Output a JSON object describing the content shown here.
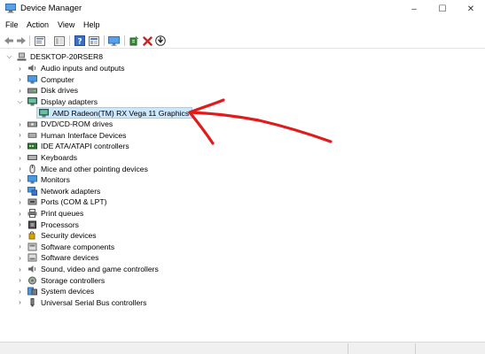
{
  "window": {
    "title": "Device Manager",
    "controls": {
      "minimize": "–",
      "maximize": "☐",
      "close": "✕"
    }
  },
  "menu": [
    "File",
    "Action",
    "View",
    "Help"
  ],
  "toolbar": {
    "buttons": [
      "back-icon",
      "forward-icon",
      "properties-sheet-icon",
      "show-hide-console-tree-icon",
      "help-icon",
      "action-pane-icon",
      "monitor-icon",
      "update-driver-icon",
      "uninstall-icon",
      "scan-hardware-icon"
    ]
  },
  "tree": {
    "root": {
      "label": "DESKTOP-20RSER8",
      "expanded": true
    },
    "categories": [
      {
        "label": "Audio inputs and outputs",
        "expanded": false
      },
      {
        "label": "Computer",
        "expanded": false
      },
      {
        "label": "Disk drives",
        "expanded": false
      },
      {
        "label": "Display adapters",
        "expanded": true
      },
      {
        "label": "AMD Radeon(TM) RX Vega 11 Graphics",
        "child": true,
        "selected": true
      },
      {
        "label": "DVD/CD-ROM drives",
        "expanded": false
      },
      {
        "label": "Human Interface Devices",
        "expanded": false
      },
      {
        "label": "IDE ATA/ATAPI controllers",
        "expanded": false
      },
      {
        "label": "Keyboards",
        "expanded": false
      },
      {
        "label": "Mice and other pointing devices",
        "expanded": false
      },
      {
        "label": "Monitors",
        "expanded": false
      },
      {
        "label": "Network adapters",
        "expanded": false
      },
      {
        "label": "Ports (COM & LPT)",
        "expanded": false
      },
      {
        "label": "Print queues",
        "expanded": false
      },
      {
        "label": "Processors",
        "expanded": false
      },
      {
        "label": "Security devices",
        "expanded": false
      },
      {
        "label": "Software components",
        "expanded": false
      },
      {
        "label": "Software devices",
        "expanded": false
      },
      {
        "label": "Sound, video and game controllers",
        "expanded": false
      },
      {
        "label": "Storage controllers",
        "expanded": false
      },
      {
        "label": "System devices",
        "expanded": false
      },
      {
        "label": "Universal Serial Bus controllers",
        "expanded": false
      }
    ]
  },
  "colors": {
    "selection_bg": "#cce8ff",
    "selection_border": "#99d1ff",
    "annotation_arrow": "#e01b1b",
    "statusbar_bg": "#f0f0f0"
  }
}
